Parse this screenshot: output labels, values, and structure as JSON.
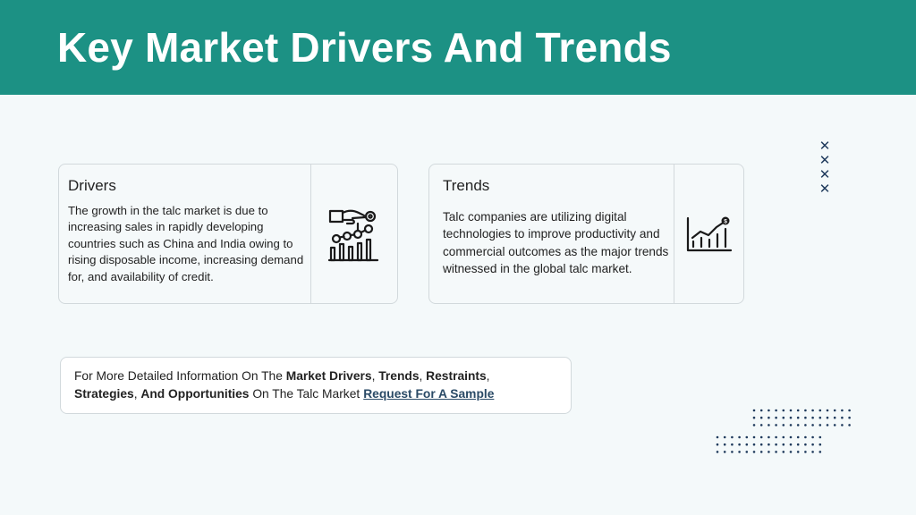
{
  "header": {
    "title": "Key Market Drivers And Trends"
  },
  "drivers": {
    "title": "Drivers",
    "text": "The growth in the talc market is due to increasing sales in rapidly developing countries such as China and India owing to rising disposable income, increasing demand for, and availability of credit.",
    "icon": "hand-growth-chart-icon"
  },
  "trends": {
    "title": "Trends",
    "text": "Talc companies are utilizing digital technologies to improve productivity and commercial outcomes as the major trends witnessed in the global talc market.",
    "icon": "dollar-bar-chart-icon"
  },
  "info": {
    "lead": "For More Detailed Information On The ",
    "t1": "Market Drivers",
    "s1": ", ",
    "t2": "Trends",
    "s2": ", ",
    "t3": "Restraints",
    "s3": ",",
    "t4": "Strategies",
    "s4": ", ",
    "t5": "And Opportunities",
    "tail": " On The Talc Market",
    "link": "Request For A Sample"
  },
  "colors": {
    "header_bg": "#1c9184",
    "accent_dark": "#1f3a5c",
    "link": "#2a4a66"
  }
}
